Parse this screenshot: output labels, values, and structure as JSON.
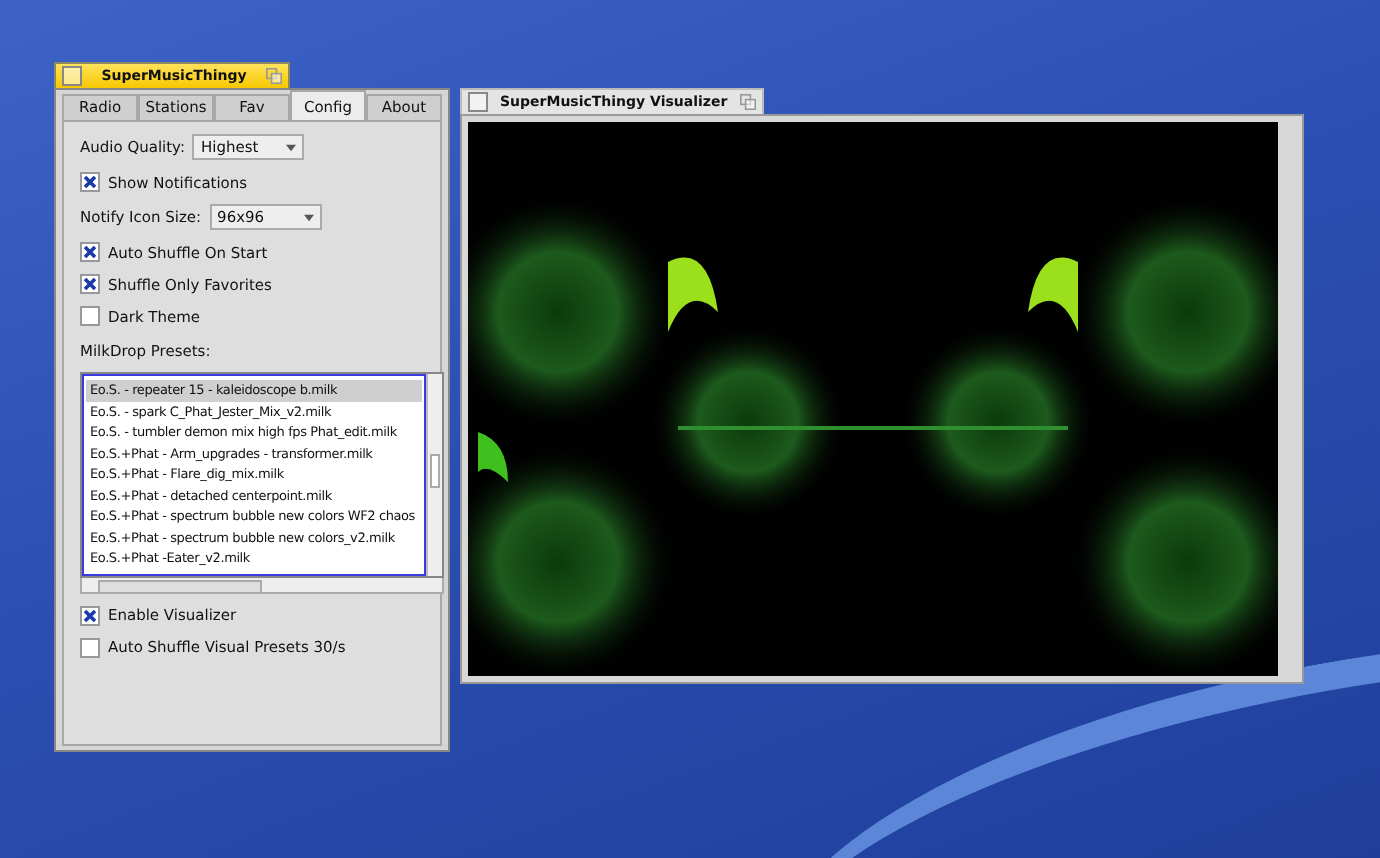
{
  "main_window": {
    "title": "SuperMusicThingy",
    "tabs": [
      {
        "label": "Radio",
        "selected": false
      },
      {
        "label": "Stations",
        "selected": false
      },
      {
        "label": "Fav",
        "selected": false
      },
      {
        "label": "Config",
        "selected": true
      },
      {
        "label": "About",
        "selected": false
      }
    ],
    "config": [
      {
        "kind": "dropdown",
        "label": "Audio Quality:",
        "value": "Highest"
      },
      {
        "kind": "checkbox",
        "label": "Show Notifications",
        "checked": true
      },
      {
        "kind": "dropdown",
        "label": "Notify Icon Size:",
        "value": "96x96"
      },
      {
        "kind": "checkbox",
        "label": "Auto Shuffle On Start",
        "checked": true
      },
      {
        "kind": "checkbox",
        "label": "Shuffle Only Favorites",
        "checked": true
      },
      {
        "kind": "checkbox",
        "label": "Dark Theme",
        "checked": false
      },
      {
        "kind": "heading",
        "label": "MilkDrop Presets:"
      },
      {
        "kind": "list",
        "items": [
          {
            "label": "Eo.S. - repeater 15 - kaleidoscope b.milk",
            "selected": true
          },
          {
            "label": "Eo.S. - spark C_Phat_Jester_Mix_v2.milk",
            "selected": false
          },
          {
            "label": "Eo.S. - tumbler demon mix high fps Phat_edit.milk",
            "selected": false
          },
          {
            "label": "Eo.S.+Phat - Arm_upgrades - transformer.milk",
            "selected": false
          },
          {
            "label": "Eo.S.+Phat - Flare_dig_mix.milk",
            "selected": false
          },
          {
            "label": "Eo.S.+Phat - detached centerpoint.milk",
            "selected": false
          },
          {
            "label": "Eo.S.+Phat - spectrum bubble new colors WF2 chaos",
            "selected": false
          },
          {
            "label": "Eo.S.+Phat - spectrum bubble new colors_v2.milk",
            "selected": false
          },
          {
            "label": "Eo.S.+Phat -Eater_v2.milk",
            "selected": false
          }
        ]
      },
      {
        "kind": "checkbox",
        "label": "Enable Visualizer",
        "checked": true
      },
      {
        "kind": "checkbox",
        "label": "Auto Shuffle Visual Presets 30/s",
        "checked": false
      }
    ]
  },
  "visualizer_window": {
    "title": "SuperMusicThingy Visualizer"
  }
}
